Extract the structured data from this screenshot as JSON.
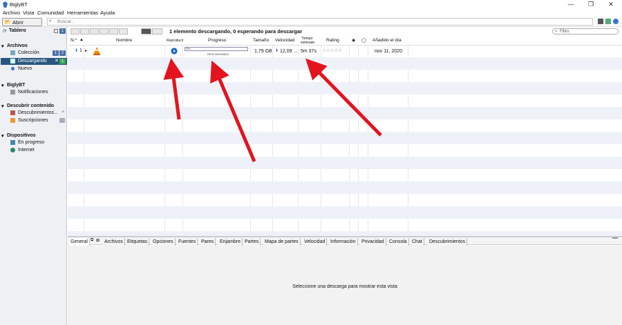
{
  "window": {
    "title": "BiglyBT",
    "controls": [
      "—",
      "❐",
      "✕"
    ]
  },
  "menu": [
    "Archivo",
    "Vista",
    "Comunidad",
    "Herramientas",
    "Ayuda"
  ],
  "toolbar": {
    "open_label": "Abrir torrents",
    "search_placeholder": "Buscar..."
  },
  "sidebar": {
    "tablero": {
      "label": "Tablero",
      "badge": "1"
    },
    "archivos": {
      "header": "Archivos",
      "items": [
        {
          "label": "Colección",
          "badges": [
            "1",
            "2"
          ]
        },
        {
          "label": "Descargando",
          "badges": [
            "1"
          ]
        },
        {
          "label": "Nuevo"
        }
      ]
    },
    "biglybt": {
      "header": "BiglyBT",
      "items": [
        {
          "label": "Notificaciones"
        }
      ]
    },
    "descubrir": {
      "header": "Descubrir contenido",
      "items": [
        {
          "label": "Descubrimientos..."
        },
        {
          "label": "Suscripciones"
        }
      ]
    },
    "dispositivos": {
      "header": "Dispositivos",
      "items": [
        {
          "label": "En progreso"
        },
        {
          "label": "Internet"
        }
      ]
    }
  },
  "content": {
    "status": "1 elemento descargando, 0 esperando para descargar",
    "filter_placeholder": "Filtro",
    "columns": {
      "num": "N.º",
      "name": "Nombre",
      "play": "Reproducir",
      "progress": "Progreso",
      "size": "Tamaño",
      "speed": "Velocidad",
      "eta_top": "Tiempo",
      "eta_bottom": "estimado",
      "rating": "Rating",
      "added": "Añadido el día"
    },
    "rows": [
      {
        "num": "1",
        "progress_label": "0%",
        "progress_status": "DESCARGANDO",
        "progress_value": 0.0,
        "size": "1,79 GB",
        "speed": "12,09 ...",
        "eta": "5m 37s",
        "rating": "☆☆☆☆☆",
        "added": "nov 11, 2020"
      }
    ]
  },
  "bottom_tabs": [
    "General",
    "Archivos",
    "Etiquetas",
    "Opciones",
    "Fuentes",
    "Pares",
    "Enjambre",
    "Partes",
    "Mapa de partes",
    "Velocidad",
    "Información",
    "Privacidad",
    "Consola",
    "Chat",
    "Descubrimientos"
  ],
  "bottom_message": "Seleccione una descarga para mostrar esta vista",
  "colors": {
    "sidebar_bg": "#eef0f4",
    "selected": "#2a567e",
    "stripe": "#eef2f8",
    "arrow": "#e3141e",
    "badge_blue": "#4a6fa5",
    "badge_green": "#3aa655"
  }
}
